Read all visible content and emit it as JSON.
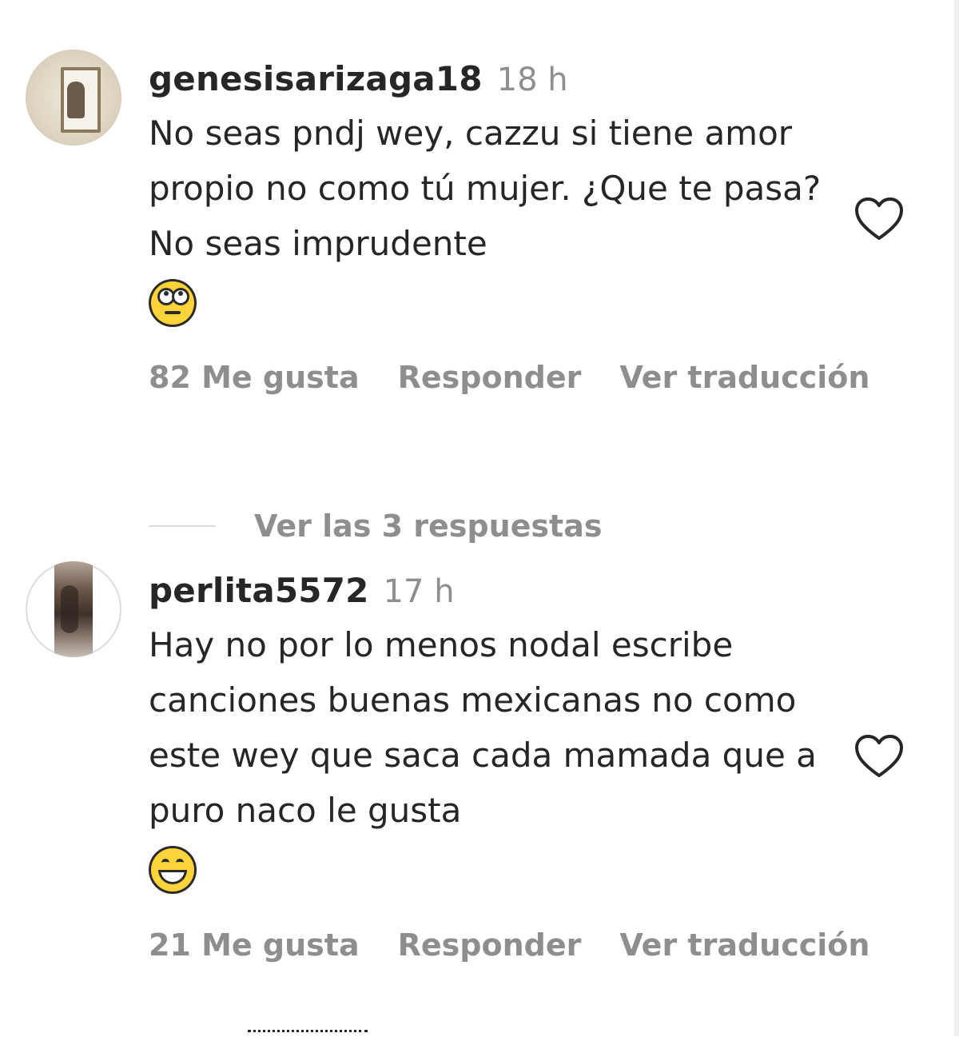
{
  "comments": [
    {
      "username": "genesisarizaga18",
      "time": "18 h",
      "text": "No seas pndj wey, cazzu si tiene amor propio no como tú mujer. ¿Que te pasa? No seas imprudente",
      "emoji": "face-with-rolling-eyes",
      "likes": "82 Me gusta",
      "reply": "Responder",
      "translate": "Ver traducción"
    },
    {
      "username": "perlita5572",
      "time": "17 h",
      "text": "Hay no por lo menos nodal escribe canciones buenas mexicanas no como este wey que saca cada mamada que a puro naco le gusta",
      "emoji": "grinning-face-with-smiling-eyes",
      "likes": "21 Me gusta",
      "reply": "Responder",
      "translate": "Ver traducción"
    }
  ],
  "view_replies": "Ver las 3 respuestas",
  "icons": {
    "like": "heart-outline-icon"
  },
  "colors": {
    "text": "#262626",
    "muted": "#8e8e8e",
    "emoji": "#ffd43b"
  }
}
